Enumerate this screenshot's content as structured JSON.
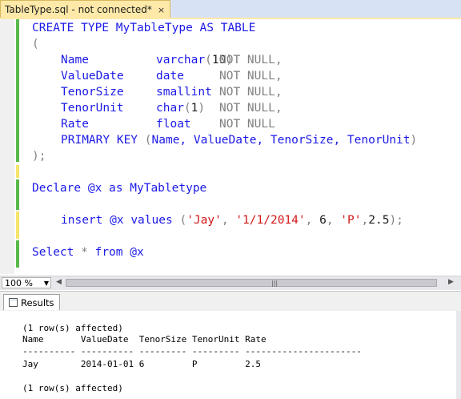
{
  "tab": {
    "title": "TableType.sql - not connected*",
    "close": "×"
  },
  "code": {
    "create_kw": "CREATE TYPE",
    "type_name": "MyTableType",
    "as_table_kw": "AS TABLE",
    "open_paren": "(",
    "columns": [
      {
        "name": "Name",
        "type": "varchar",
        "size": "10",
        "constraint": "NOT NULL",
        "comma": ","
      },
      {
        "name": "ValueDate",
        "type": "date",
        "size": "",
        "constraint": "NOT NULL",
        "comma": ","
      },
      {
        "name": "TenorSize",
        "type": "smallint",
        "size": "",
        "constraint": "NOT NULL",
        "comma": ","
      },
      {
        "name": "TenorUnit",
        "type": "char",
        "size": "1",
        "constraint": "NOT NULL",
        "comma": ","
      },
      {
        "name": "Rate",
        "type": "float",
        "size": "",
        "constraint": "NOT NULL",
        "comma": ""
      }
    ],
    "primary_key_kw": "PRIMARY KEY",
    "pk_columns": "Name, ValueDate, TenorSize, TenorUnit",
    "close_paren": ");",
    "declare_kw": "Declare",
    "var": "@x",
    "as_kw": "as",
    "declare_type": "MyTabletype",
    "insert_kw": "insert",
    "values_kw": "values",
    "val_name": "'Jay'",
    "val_date": "'1/1/2014'",
    "val_size": "6",
    "val_unit": "'P'",
    "val_rate": "2.5",
    "select_kw": "Select",
    "star": "*",
    "from_kw": "from"
  },
  "toolbar": {
    "zoom": "100 %"
  },
  "results_tab": {
    "label": "Results"
  },
  "results": {
    "affected_top": "(1 row(s) affected)",
    "header": "Name       ValueDate  TenorSize TenorUnit Rate",
    "separator": "---------- ---------- --------- --------- ----------------------",
    "row": "Jay        2014-01-01 6         P         2.5",
    "affected_bottom": "(1 row(s) affected)"
  },
  "colors": {
    "keyword": "#1c1ae8",
    "string": "#d21717",
    "gray": "#808080",
    "system": "#ff00ff",
    "changed_bar": "#59b94a",
    "unsaved_bar": "#f5e46a"
  }
}
